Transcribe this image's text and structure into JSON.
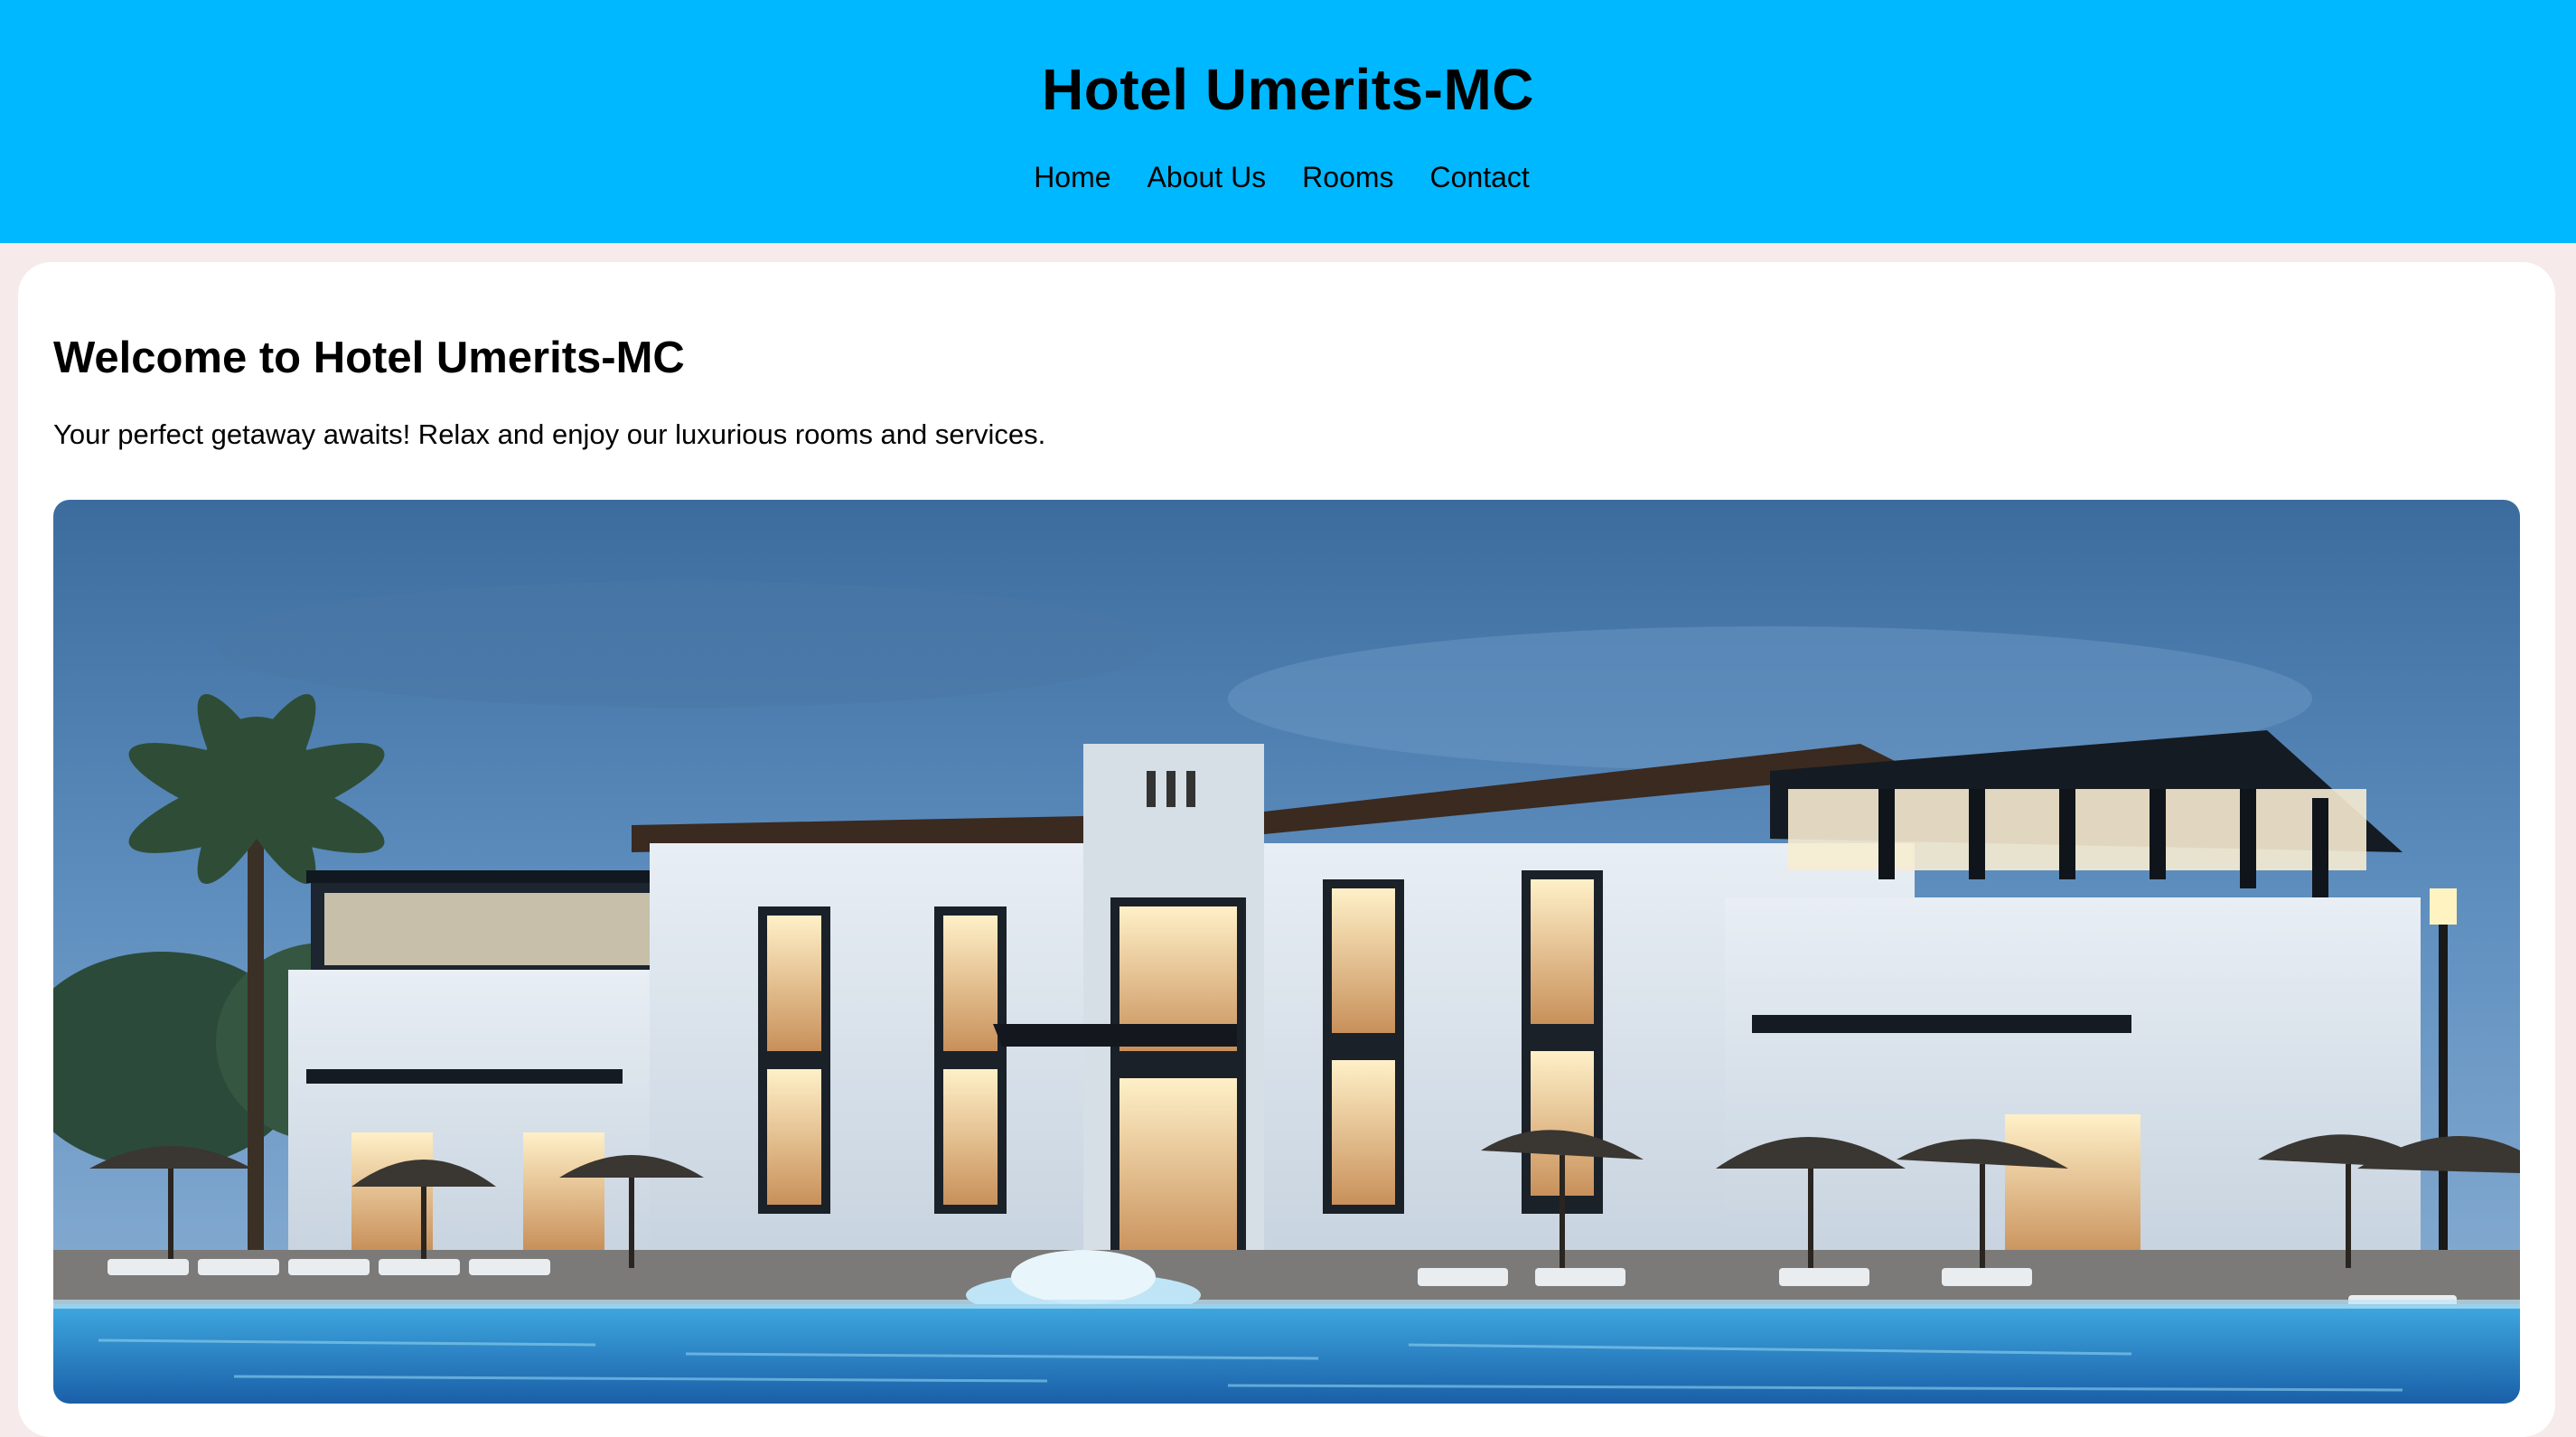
{
  "header": {
    "title": "Hotel Umerits-MC",
    "nav": [
      {
        "label": "Home"
      },
      {
        "label": "About Us"
      },
      {
        "label": "Rooms"
      },
      {
        "label": "Contact"
      }
    ]
  },
  "main": {
    "heading": "Welcome to Hotel Umerits-MC",
    "tagline": "Your perfect getaway awaits! Relax and enjoy our luxurious rooms and services."
  },
  "colors": {
    "header_bg": "#00b8ff",
    "page_bg": "#f6eaea",
    "card_bg": "#ffffff"
  }
}
